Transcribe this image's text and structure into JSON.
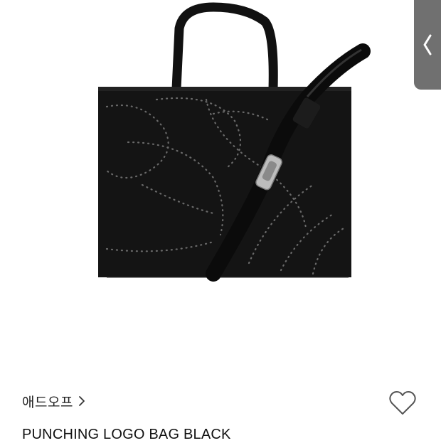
{
  "product": {
    "image_icon": "tote-bag-photo",
    "brand": "애드오프",
    "title": "PUNCHING LOGO BAG BLACK"
  },
  "icons": {
    "back": "chevron-left-icon",
    "brand_link": "chevron-right-icon",
    "wishlist": "heart-outline-icon"
  },
  "colors": {
    "bag": "#111111",
    "back_tab": "#707070",
    "text": "#222222"
  }
}
